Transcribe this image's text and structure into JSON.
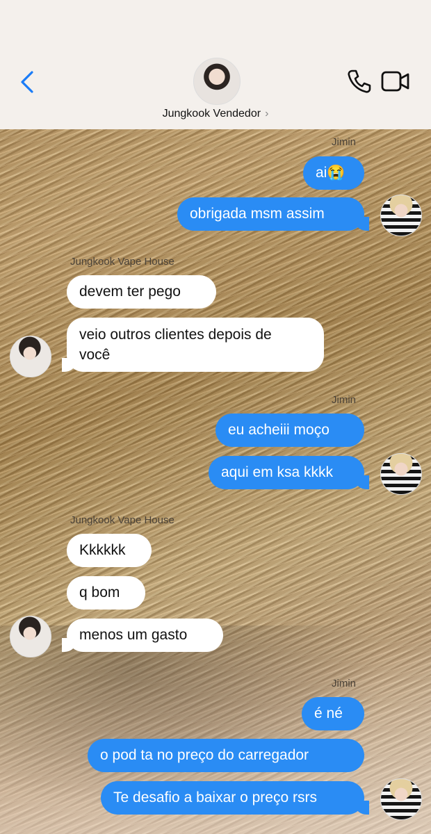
{
  "header": {
    "contact_name": "Jungkook Vendedor",
    "chevron": "›",
    "icons": {
      "back": "chevron-left-icon",
      "call": "phone-icon",
      "video": "video-camera-icon"
    },
    "accent": "#1a7cf7"
  },
  "senders": {
    "me": "Jimin",
    "them": "Jungkook Vape House"
  },
  "messages": [
    {
      "from": "me",
      "text": "ai😭"
    },
    {
      "from": "me",
      "text": "obrigada msm assim"
    },
    {
      "from": "them",
      "text": "devem ter pego"
    },
    {
      "from": "them",
      "text": "veio outros clientes depois de"
    },
    {
      "from": "them",
      "text": "você"
    },
    {
      "from": "me",
      "text": "eu acheiii moço"
    },
    {
      "from": "me",
      "text": "aqui em ksa kkkk"
    },
    {
      "from": "them",
      "text": "Kkkkkk"
    },
    {
      "from": "them",
      "text": "q bom"
    },
    {
      "from": "them",
      "text": "menos um gasto"
    },
    {
      "from": "me",
      "text": "é né"
    },
    {
      "from": "me",
      "text": "o pod ta no preço do carregador"
    },
    {
      "from": "me",
      "text": "Te desafio a baixar o preço rsrs"
    }
  ],
  "colors": {
    "outgoing": "#2a8cf4",
    "incoming": "#ffffff",
    "header_bg": "#f4f0ec"
  }
}
